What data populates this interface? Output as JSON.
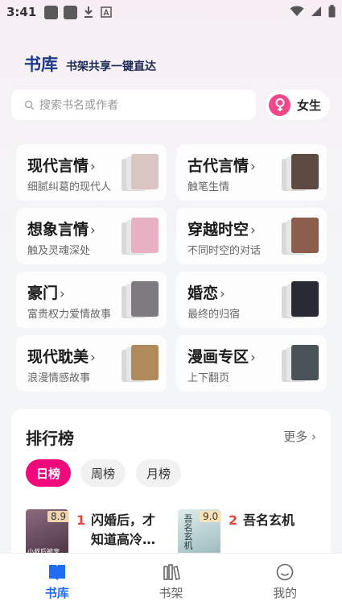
{
  "status_bar": {
    "time": "3:41"
  },
  "header": {
    "title": "书库",
    "subtitle": "书架共享一键直达"
  },
  "search": {
    "placeholder": "搜索书名或作者"
  },
  "gender": {
    "label": "女生",
    "color": "#f0488a"
  },
  "categories": [
    {
      "title": "现代言情",
      "desc": "细腻纠葛的现代人",
      "cover_color": "#d9c6c3"
    },
    {
      "title": "古代言情",
      "desc": "触笔生情",
      "cover_color": "#5d4a42"
    },
    {
      "title": "想象言情",
      "desc": "触及灵魂深处",
      "cover_color": "#e9b2c4"
    },
    {
      "title": "穿越时空",
      "desc": "不同时空的对话",
      "cover_color": "#8c5e4c"
    },
    {
      "title": "豪门",
      "desc": "富贵权力爱情故事",
      "cover_color": "#7d7a80"
    },
    {
      "title": "婚恋",
      "desc": "最终的归宿",
      "cover_color": "#2a2a34"
    },
    {
      "title": "现代耽美",
      "desc": "浪漫情感故事",
      "cover_color": "#b08a5a"
    },
    {
      "title": "漫画专区",
      "desc": "上下翻页",
      "cover_color": "#4a5358"
    }
  ],
  "ranking": {
    "title": "排行榜",
    "more": "更多",
    "tabs": [
      "日榜",
      "周榜",
      "月榜"
    ],
    "active_color": "#f2087a",
    "books": [
      {
        "rank": "1",
        "name": "闪婚后，才知道高冷…",
        "score": "8.9",
        "cover_color": "#5a3f53",
        "cover_text": "小叔后被宠"
      },
      {
        "rank": "2",
        "name": "吾名玄机",
        "score": "9.0",
        "cover_color": "#a8c6c8",
        "cover_text": "吾名玄机"
      }
    ]
  },
  "tabbar": [
    {
      "label": "书库",
      "icon": "library-book-icon",
      "active": true
    },
    {
      "label": "书架",
      "icon": "bookshelf-icon",
      "active": false
    },
    {
      "label": "我的",
      "icon": "smiley-profile-icon",
      "active": false
    }
  ],
  "colors": {
    "accent_blue": "#1f6cf0",
    "rank_red": "#e0453b"
  }
}
